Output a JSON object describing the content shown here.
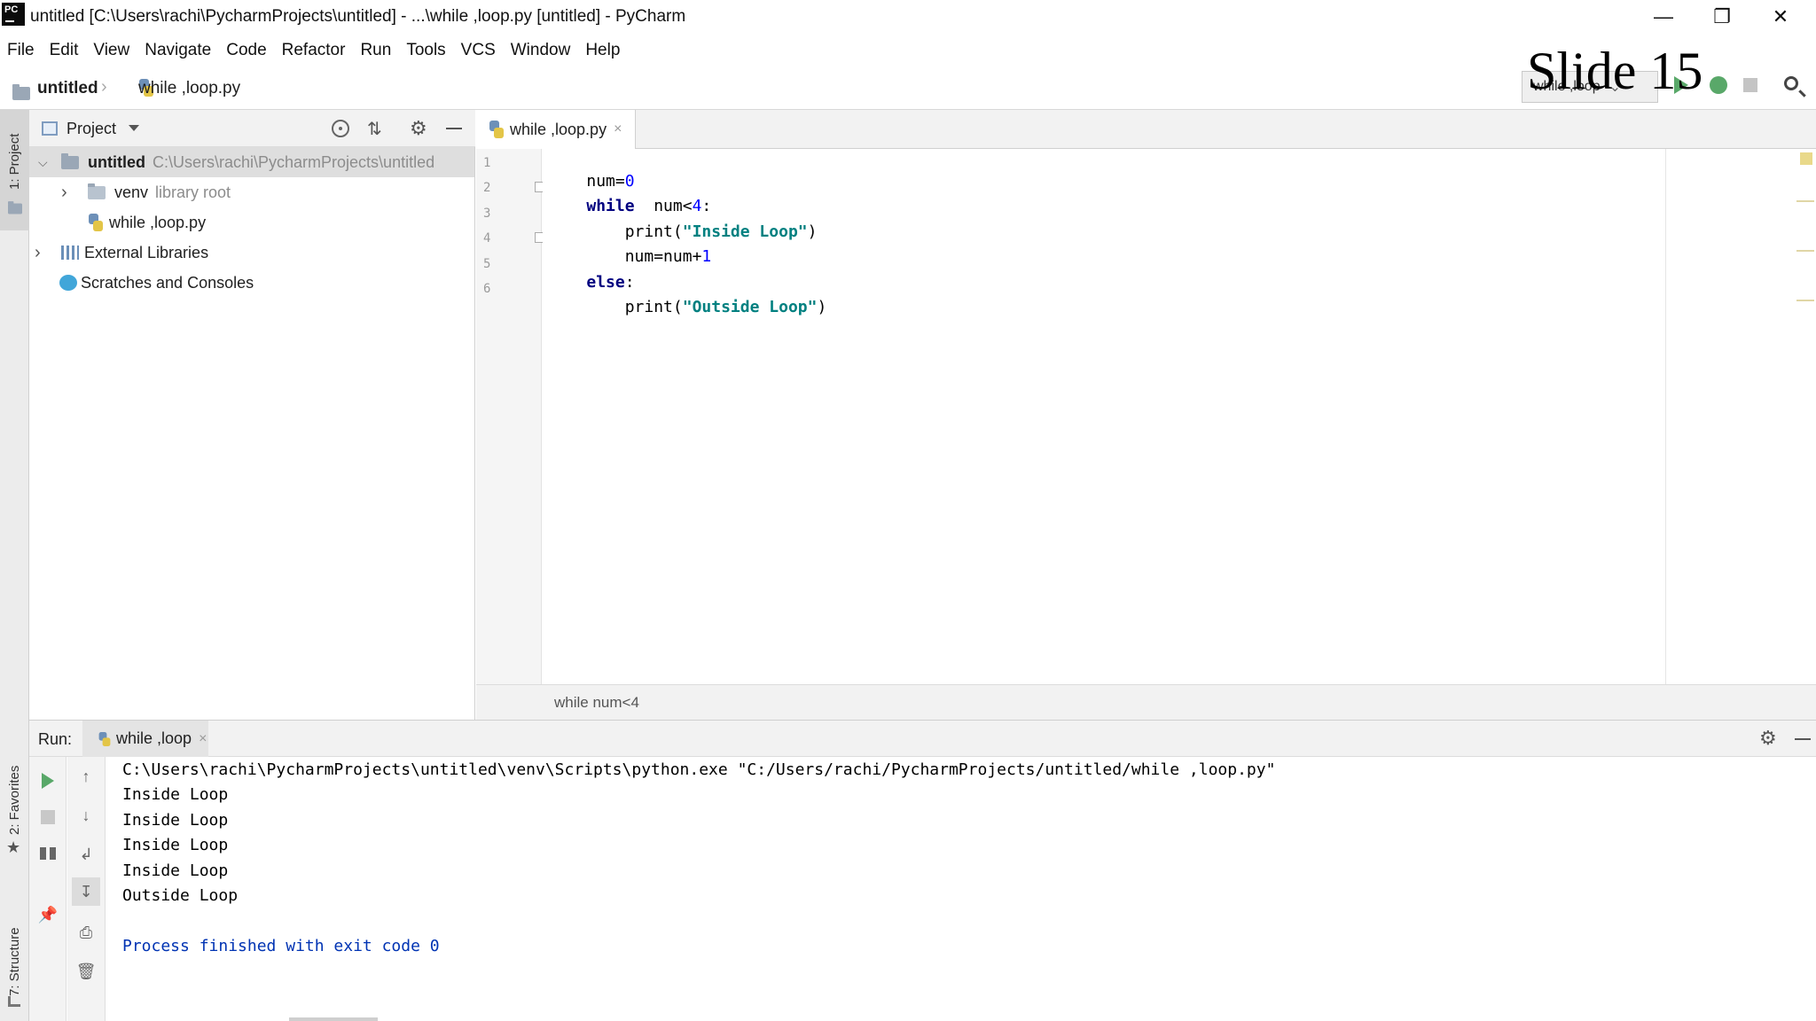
{
  "window": {
    "logo": "PC",
    "title": "untitled [C:\\Users\\rachi\\PycharmProjects\\untitled] - ...\\while ,loop.py [untitled] - PyCharm",
    "minimize_glyph": "—",
    "maximize_glyph": "❐",
    "close_glyph": "✕"
  },
  "menu": [
    "File",
    "Edit",
    "View",
    "Navigate",
    "Code",
    "Refactor",
    "Run",
    "Tools",
    "VCS",
    "Window",
    "Help"
  ],
  "navbar": {
    "project": "untitled",
    "separator": "›",
    "file": "while ,loop.py",
    "run_config": "while ,loop"
  },
  "overlay": {
    "slide_label": "Slide 15"
  },
  "left_strip": {
    "project_tab": "1: Project",
    "favorites_tab": "2: Favorites",
    "structure_tab": "7: Structure"
  },
  "project_panel": {
    "title": "Project",
    "tree": [
      {
        "name": "untitled",
        "detail": "C:\\Users\\rachi\\PycharmProjects\\untitled",
        "expander": "⌵"
      },
      {
        "name": "venv",
        "detail": "library root",
        "expander": "›"
      },
      {
        "name": "while ,loop.py",
        "detail": "",
        "expander": ""
      },
      {
        "name": "External Libraries",
        "detail": "",
        "expander": "›"
      },
      {
        "name": "Scratches and Consoles",
        "detail": "",
        "expander": ""
      }
    ]
  },
  "editor": {
    "tab_label": "while ,loop.py",
    "tab_close": "×",
    "line_numbers": [
      "1",
      "2",
      "3",
      "4",
      "5",
      "6"
    ],
    "lines": [
      {
        "kw": "",
        "text": "num=0"
      },
      {
        "kw": "while",
        "text": "  num<4:"
      },
      {
        "kw": "",
        "text": "    print(\"Inside Loop\")"
      },
      {
        "kw": "",
        "text": "    num=num+1"
      },
      {
        "kw": "else",
        "text": ":"
      },
      {
        "kw": "",
        "text": "    print(\"Outside Loop\")"
      }
    ],
    "breadcrumb": "while num<4"
  },
  "run_panel": {
    "label": "Run:",
    "tab_label": "while ,loop",
    "tab_close": "×",
    "console": [
      "C:\\Users\\rachi\\PycharmProjects\\untitled\\venv\\Scripts\\python.exe \"C:/Users/rachi/PycharmProjects/untitled/while ,loop.py\"",
      "Inside Loop",
      "Inside Loop",
      "Inside Loop",
      "Inside Loop",
      "Outside Loop",
      "",
      "Process finished with exit code 0"
    ]
  },
  "colors": {
    "keyword": "#000080",
    "string": "#008080",
    "number": "#0000ff",
    "process_line": "#0033b3",
    "run_green": "#59a869"
  }
}
